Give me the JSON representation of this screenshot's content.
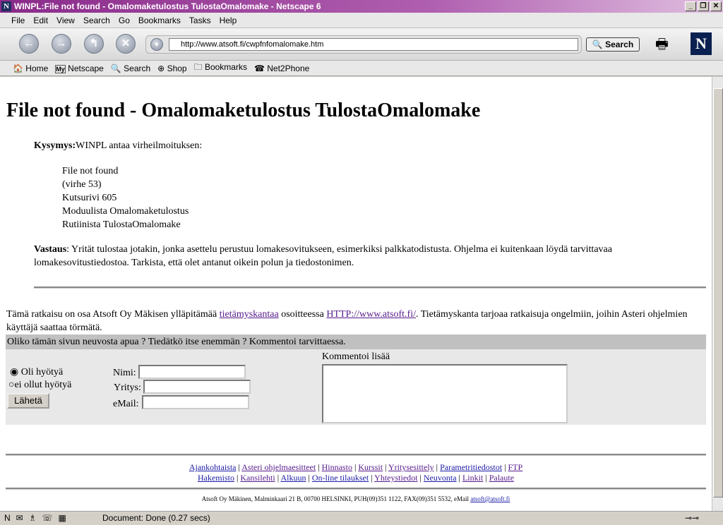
{
  "window": {
    "title": "WINPL:File not found - Omalomaketulostus TulostaOmalomake - Netscape 6"
  },
  "menu": [
    "File",
    "Edit",
    "View",
    "Search",
    "Go",
    "Bookmarks",
    "Tasks",
    "Help"
  ],
  "nav": {
    "url": "http://www.atsoft.fi/cwpfnfomalomake.htm",
    "search_label": "Search"
  },
  "personal_toolbar": [
    "Home",
    "Netscape",
    "Search",
    "Shop",
    "Bookmarks",
    "Net2Phone"
  ],
  "page": {
    "heading": "File not found - Omalomaketulostus TulostaOmalomake",
    "question_label": "Kysymys:",
    "question_text": "WINPL antaa virheilmoituksen:",
    "error_lines": [
      "File not found",
      "(virhe 53)",
      "Kutsurivi 605",
      "Moduulista Omalomaketulostus",
      "Rutiinista TulostaOmalomake"
    ],
    "answer_label": "Vastaus",
    "answer_text": ": Yrität tulostaa jotakin, jonka asettelu perustuu lomakesovitukseen, esimerkiksi palkkatodistusta. Ohjelma ei kuitenkaan löydä tarvittavaa lomakesovitustiedostoa. Tarkista, että olet antanut oikein polun ja tiedostonimen.",
    "info_pre": "Tämä ratkaisu on osa Atsoft Oy Mäkisen ylläpitämää ",
    "info_link1": "tietämyskantaa",
    "info_mid": " osoitteessa ",
    "info_link2": "HTTP://www.atsoft.fi/",
    "info_post": ". Tietämyskanta tarjoaa ratkaisuja ongelmiin, joihin Asteri ohjelmien käyttäjä saattaa törmätä.",
    "feedback_bar": "Oliko tämän sivun neuvosta apua ? Tiedätkö itse enemmän ? Kommentoi tarvittaessa.",
    "form": {
      "radio1": "Oli hyötyä",
      "radio2": "ei ollut hyötyä",
      "submit": "Lähetä",
      "name_label": "Nimi:",
      "company_label": "Yritys:",
      "email_label": "eMail:",
      "comment_label": "Kommentoi lisää"
    },
    "footer_links_1": [
      "Ajankohtaista",
      "Asteri ohjelmaesitteet",
      "Hinnasto",
      "Kurssit",
      "Yritysesittely",
      "Parametritiedostot",
      "FTP"
    ],
    "footer_links_2": [
      "Hakemisto",
      "Kansilehti",
      "Alkuun",
      "On-line tilaukset",
      "Yhteystiedot",
      "Neuvonta",
      "Linkit",
      "Palaute"
    ],
    "address": "Atsoft Oy Mäkinen, Malminkaari 21 B, 00700 HELSINKI, PUH(09)351 1122, FAX(09)351 5532, eMail ",
    "address_email": "atsoft@atsoft.fi"
  },
  "status": {
    "text": "Document: Done (0.27 secs)"
  }
}
